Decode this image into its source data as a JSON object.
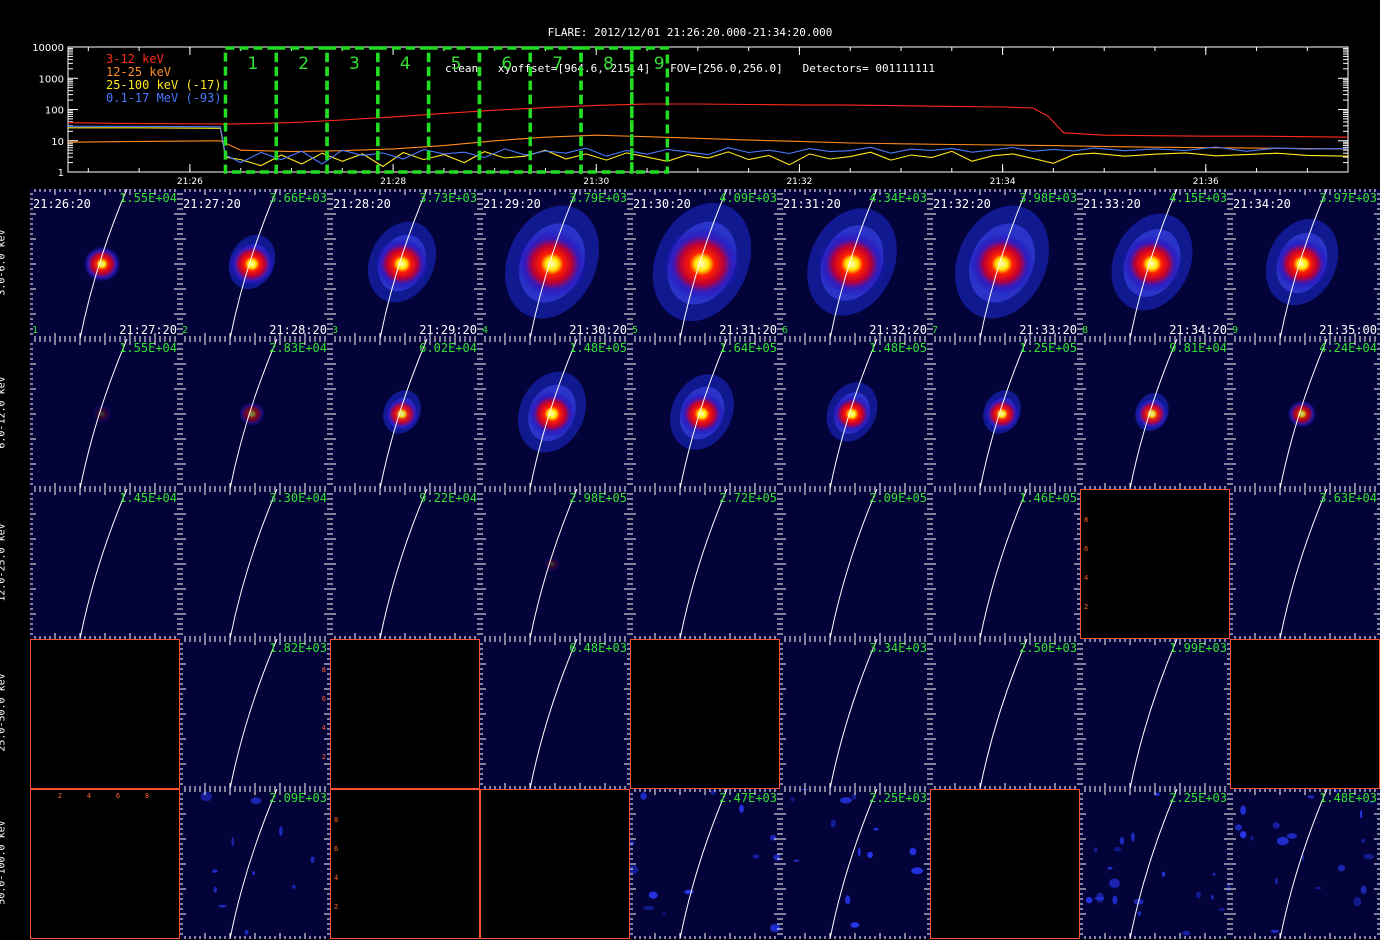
{
  "header": {
    "line1": "FLARE: 2012/12/01 21:26:20.000-21:34:20.000",
    "line2": "clean   xyoffset=[964.6,-215.4]   FOV=[256.0,256.0]   Detectors= 001111111"
  },
  "chart_data": [
    {
      "type": "line",
      "scale": "log",
      "ylim": [
        1,
        10000
      ],
      "yticks": [
        "1",
        "10",
        "100",
        "1000",
        "10000"
      ],
      "xticks": [
        {
          "t": 26.0,
          "label": "21:26"
        },
        {
          "t": 28.0,
          "label": "21:28"
        },
        {
          "t": 30.0,
          "label": "21:30"
        },
        {
          "t": 32.0,
          "label": "21:32"
        },
        {
          "t": 34.0,
          "label": "21:34"
        },
        {
          "t": 36.0,
          "label": "21:36"
        }
      ],
      "xlim": [
        24.8,
        37.4
      ],
      "series": [
        {
          "name": "3-12 keV",
          "color": "#ff2a1a",
          "t": [
            24.8,
            25.3,
            25.8,
            26.35,
            26.7,
            27.0,
            27.5,
            28.0,
            28.5,
            29.0,
            29.5,
            30.0,
            30.5,
            31.0,
            31.5,
            32.0,
            32.5,
            33.0,
            33.5,
            34.0,
            34.3,
            34.45,
            34.6,
            35.0,
            35.5,
            36.0,
            36.5,
            37.0,
            37.4
          ],
          "v": [
            38,
            36,
            35,
            34,
            36,
            38,
            46,
            58,
            75,
            95,
            115,
            135,
            150,
            150,
            145,
            140,
            138,
            132,
            126,
            120,
            112,
            60,
            18,
            15,
            14.5,
            14,
            14,
            13.5,
            13
          ]
        },
        {
          "name": "12-25 keV",
          "color": "#ff8c22",
          "t": [
            24.8,
            25.5,
            26.3,
            26.5,
            27.0,
            27.5,
            28.0,
            28.5,
            29.0,
            29.5,
            30.0,
            30.5,
            31.0,
            31.5,
            32.0,
            32.5,
            33.0,
            33.5,
            34.0,
            34.5,
            35.0,
            35.5,
            36.0,
            36.5,
            37.0,
            37.4
          ],
          "v": [
            9,
            9.5,
            10,
            5,
            4.5,
            4.8,
            5.5,
            7,
            10,
            13,
            15,
            13.5,
            12,
            10.5,
            9.5,
            8.5,
            8,
            7.6,
            7.3,
            7,
            6.5,
            6.2,
            6,
            5.8,
            5.6,
            5.5
          ]
        },
        {
          "name": "25-100 keV (-17)",
          "color": "#ffe81f",
          "t": [
            24.8,
            25.5,
            26.3,
            26.35,
            26.5,
            26.7,
            26.9,
            27.1,
            27.3,
            27.5,
            27.7,
            27.9,
            28.1,
            28.3,
            28.5,
            28.7,
            28.9,
            29.1,
            29.3,
            29.5,
            29.7,
            29.9,
            30.1,
            30.3,
            30.5,
            30.7,
            30.9,
            31.1,
            31.3,
            31.5,
            31.7,
            31.9,
            32.1,
            32.3,
            32.5,
            32.7,
            32.9,
            33.1,
            33.3,
            33.5,
            33.7,
            33.9,
            34.1,
            34.3,
            34.5,
            34.7,
            34.9,
            35.2,
            35.5,
            35.8,
            36.1,
            36.4,
            36.7,
            37.0,
            37.4
          ],
          "v": [
            26,
            26,
            25,
            3,
            2.5,
            1.6,
            3.5,
            1.8,
            4,
            2.2,
            3.8,
            1.5,
            4.2,
            2.5,
            3.6,
            2,
            4.5,
            2.8,
            3.2,
            5,
            2.6,
            3.8,
            2.4,
            4.1,
            3,
            2.2,
            3.6,
            2.8,
            4.4,
            2.5,
            3.4,
            1.7,
            3.8,
            2.6,
            3.1,
            4.3,
            2.4,
            3.5,
            2.9,
            4.6,
            2.2,
            3.3,
            3.8,
            2.7,
            1.9,
            3.6,
            4,
            3.2,
            3.7,
            4.1,
            3.3,
            3.6,
            4,
            3.4,
            3.2
          ]
        },
        {
          "name": "0.1-17 MeV (-93)",
          "color": "#4a78ff",
          "t": [
            24.8,
            25.5,
            26.3,
            26.35,
            26.5,
            26.7,
            26.9,
            27.1,
            27.3,
            27.5,
            27.7,
            27.9,
            28.1,
            28.3,
            28.5,
            28.7,
            28.9,
            29.1,
            29.3,
            29.5,
            29.7,
            29.9,
            30.1,
            30.3,
            30.5,
            30.7,
            30.9,
            31.1,
            31.3,
            31.5,
            31.7,
            31.9,
            32.1,
            32.3,
            32.5,
            32.7,
            32.9,
            33.1,
            33.3,
            33.5,
            33.7,
            33.9,
            34.1,
            34.3,
            34.5,
            34.7,
            34.9,
            35.2,
            35.5,
            35.8,
            36.1,
            36.4,
            36.7,
            37.0,
            37.4
          ],
          "v": [
            29,
            29,
            28,
            3.5,
            2,
            4.2,
            2.5,
            4.6,
            1.8,
            5,
            3.4,
            4.1,
            2.6,
            5.2,
            3.8,
            4.3,
            2.9,
            5.5,
            3.5,
            4.7,
            4,
            5.8,
            3.2,
            4.9,
            3.7,
            5.3,
            4.4,
            3.6,
            6,
            4.2,
            5,
            3.9,
            5.6,
            4.5,
            4.8,
            6.2,
            4,
            5.4,
            4.9,
            5.7,
            4.3,
            5.1,
            6.1,
            4.6,
            5.3,
            4.7,
            5.9,
            4.8,
            5.5,
            4.9,
            6.3,
            4.6,
            5.8,
            5.4,
            5.6
          ]
        }
      ],
      "intervals": [
        {
          "label": "1",
          "t0": 26.35,
          "t1": 26.85
        },
        {
          "label": "2",
          "t0": 26.85,
          "t1": 27.35
        },
        {
          "label": "3",
          "t0": 27.35,
          "t1": 27.85
        },
        {
          "label": "4",
          "t0": 27.85,
          "t1": 28.35
        },
        {
          "label": "5",
          "t0": 28.35,
          "t1": 28.85
        },
        {
          "label": "6",
          "t0": 28.85,
          "t1": 29.35
        },
        {
          "label": "7",
          "t0": 29.35,
          "t1": 29.85
        },
        {
          "label": "8",
          "t0": 29.85,
          "t1": 30.35
        },
        {
          "label": "9",
          "t0": 30.35,
          "t1": 30.7
        }
      ]
    },
    {
      "type": "heatmap",
      "rows": [
        {
          "label": "3.0-6.0 keV",
          "cells": [
            {
              "max": "1.55E+04",
              "start": "21:26:20",
              "end": "21:27:20",
              "index": "1",
              "size": 0.9,
              "extent": 0,
              "i": 0.95
            },
            {
              "max": "3.66E+03",
              "start": "21:27:20",
              "end": "21:28:20",
              "index": "2",
              "size": 1.2,
              "extent": 0.5,
              "i": 1
            },
            {
              "max": "3.73E+03",
              "start": "21:28:20",
              "end": "21:29:20",
              "index": "3",
              "size": 1.5,
              "extent": 1,
              "i": 1
            },
            {
              "max": "3.79E+03",
              "start": "21:29:20",
              "end": "21:30:20",
              "index": "4",
              "size": 2.1,
              "extent": 1.6,
              "i": 1
            },
            {
              "max": "4.09E+03",
              "start": "21:30:20",
              "end": "21:31:20",
              "index": "5",
              "size": 2.3,
              "extent": 1.7,
              "i": 1
            },
            {
              "max": "4.34E+03",
              "start": "21:31:20",
              "end": "21:32:20",
              "index": "6",
              "size": 2.0,
              "extent": 1.5,
              "i": 1
            },
            {
              "max": "3.98E+03",
              "start": "21:32:20",
              "end": "21:33:20",
              "index": "7",
              "size": 1.9,
              "extent": 1.6,
              "i": 1
            },
            {
              "max": "4.15E+03",
              "start": "21:33:20",
              "end": "21:34:20",
              "index": "8",
              "size": 1.7,
              "extent": 1.3,
              "i": 1
            },
            {
              "max": "3.97E+03",
              "start": "21:34:20",
              "end": "21:35:00",
              "index": "9",
              "size": 1.5,
              "extent": 1.1,
              "i": 1
            }
          ]
        },
        {
          "label": "6.0-12.0 keV",
          "cells": [
            {
              "max": "1.55E+04",
              "size": 0.3,
              "extent": 0,
              "i": 0.2
            },
            {
              "max": "2.83E+04",
              "size": 0.5,
              "extent": 0,
              "i": 0.5
            },
            {
              "max": "6.02E+04",
              "size": 0.8,
              "extent": 0.3,
              "i": 0.9
            },
            {
              "max": "1.48E+05",
              "size": 1.3,
              "extent": 1,
              "i": 1
            },
            {
              "max": "1.64E+05",
              "size": 1.2,
              "extent": 0.9,
              "i": 1
            },
            {
              "max": "1.48E+05",
              "size": 1.0,
              "extent": 0.6,
              "i": 1
            },
            {
              "max": "1.25E+05",
              "size": 0.85,
              "extent": 0.3,
              "i": 0.95
            },
            {
              "max": "9.81E+04",
              "size": 0.75,
              "extent": 0.2,
              "i": 0.9
            },
            {
              "max": "4.24E+04",
              "size": 0.6,
              "extent": 0,
              "i": 0.8
            }
          ]
        },
        {
          "label": "12.0-25.0 keV",
          "cells": [
            {
              "max": "1.45E+04",
              "size": 0,
              "extent": 0,
              "i": 0
            },
            {
              "max": "3.30E+04",
              "size": 0,
              "extent": 0,
              "i": 0
            },
            {
              "max": "9.22E+04",
              "size": 0,
              "extent": 0,
              "i": 0
            },
            {
              "max": "2.98E+05",
              "size": 0.2,
              "extent": 0,
              "i": 0.2
            },
            {
              "max": "2.72E+05",
              "size": 0,
              "extent": 0,
              "i": 0
            },
            {
              "max": "2.09E+05",
              "size": 0,
              "extent": 0,
              "i": 0
            },
            {
              "max": "1.46E+05",
              "size": 0,
              "extent": 0,
              "i": 0
            },
            {
              "empty": true,
              "ticks": "left"
            },
            {
              "max": "3.63E+04",
              "size": 0,
              "extent": 0,
              "i": 0
            }
          ]
        },
        {
          "label": "25.0-50.0 keV",
          "cells": [
            {
              "empty": true
            },
            {
              "max": "1.82E+03",
              "size": 0,
              "extent": 0,
              "i": 0,
              "ticks": "right"
            },
            {
              "empty": true
            },
            {
              "max": "6.48E+03",
              "size": 0,
              "extent": 0,
              "i": 0
            },
            {
              "empty": true
            },
            {
              "max": "3.34E+03",
              "size": 0,
              "extent": 0,
              "i": 0
            },
            {
              "max": "2.50E+03",
              "size": 0,
              "extent": 0,
              "i": 0
            },
            {
              "max": "1.99E+03",
              "size": 0,
              "extent": 0,
              "i": 0
            },
            {
              "empty": true
            }
          ]
        },
        {
          "label": "50.0-100.0 keV",
          "cells": [
            {
              "empty": true,
              "ticks": "top"
            },
            {
              "max": "2.09E+03",
              "noise": 0.5
            },
            {
              "empty": true,
              "ticks": "left"
            },
            {
              "empty": true
            },
            {
              "max": "2.47E+03",
              "noise": 0.6
            },
            {
              "max": "2.25E+03",
              "noise": 0.6
            },
            {
              "empty": true
            },
            {
              "max": "2.25E+03",
              "noise": 0.9
            },
            {
              "max": "1.48E+03",
              "noise": 0.9
            }
          ]
        }
      ]
    }
  ]
}
